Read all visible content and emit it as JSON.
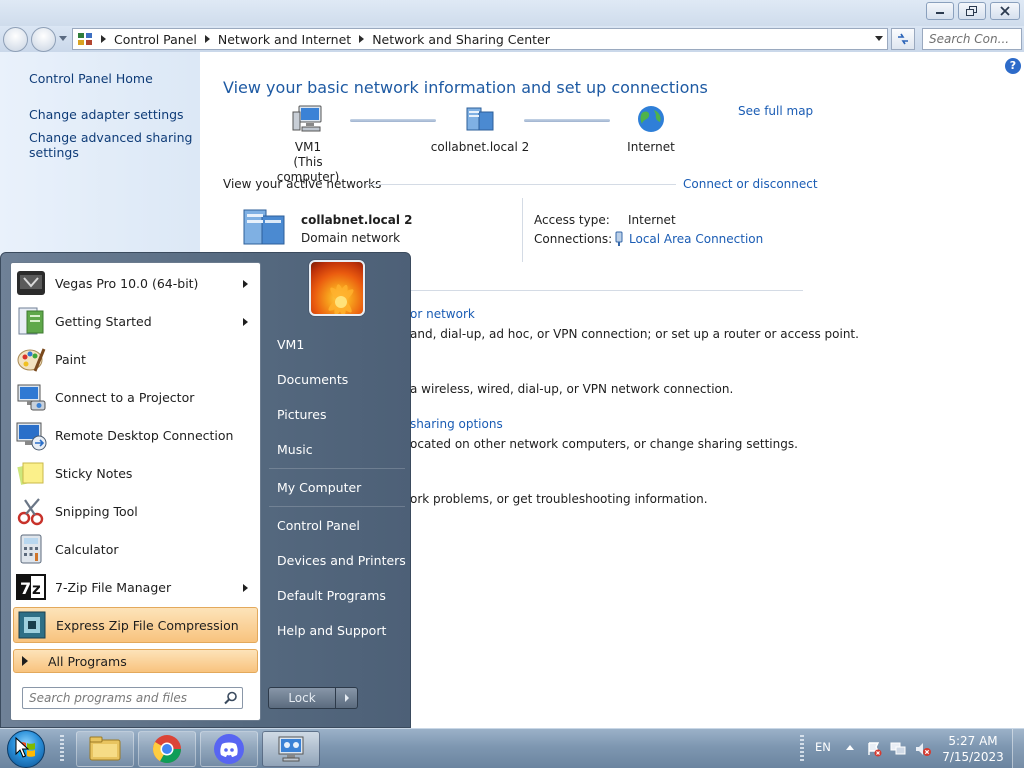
{
  "window": {
    "breadcrumbs": [
      "Control Panel",
      "Network and Internet",
      "Network and Sharing Center"
    ],
    "search_placeholder": "Search Con..."
  },
  "left_nav": {
    "home": "Control Panel Home",
    "items": [
      "Change adapter settings",
      "Change advanced sharing",
      "settings"
    ]
  },
  "main": {
    "title": "View your basic network information and set up connections",
    "see_full_map": "See full map",
    "map_nodes": [
      {
        "name": "VM1",
        "sub": "(This computer)",
        "icon": "computer-icon"
      },
      {
        "name": "collabnet.local  2",
        "sub": "",
        "icon": "domain-network-icon"
      },
      {
        "name": "Internet",
        "sub": "",
        "icon": "globe-icon"
      }
    ],
    "active_networks_label": "View your active networks",
    "connect_or_disconnect": "Connect or disconnect",
    "network_name": "collabnet.local  2",
    "network_type": "Domain network",
    "access_type_label": "Access type:",
    "access_type_value": "Internet",
    "connections_label": "Connections:",
    "connections_value": "Local Area Connection",
    "tasks": [
      {
        "link": "or network",
        "desc": ""
      },
      {
        "link": "",
        "desc": "and, dial-up, ad hoc, or VPN connection; or set up a router or access point."
      },
      {
        "link": "",
        "desc": "a wireless, wired, dial-up, or VPN network connection."
      },
      {
        "link": "sharing options",
        "desc": ""
      },
      {
        "link": "",
        "desc": "ocated on other network computers, or change sharing settings."
      },
      {
        "link": "",
        "desc": "ork problems, or get troubleshooting information."
      }
    ]
  },
  "start_menu": {
    "programs": [
      {
        "label": "Vegas Pro 10.0 (64-bit)",
        "has_submenu": true,
        "icon": "vegas-pro-icon"
      },
      {
        "label": "Getting Started",
        "has_submenu": true,
        "icon": "getting-started-icon"
      },
      {
        "label": "Paint",
        "has_submenu": false,
        "icon": "paint-icon"
      },
      {
        "label": "Connect to a Projector",
        "has_submenu": false,
        "icon": "projector-icon"
      },
      {
        "label": "Remote Desktop Connection",
        "has_submenu": false,
        "icon": "remote-desktop-icon"
      },
      {
        "label": "Sticky Notes",
        "has_submenu": false,
        "icon": "sticky-notes-icon"
      },
      {
        "label": "Snipping Tool",
        "has_submenu": false,
        "icon": "snipping-tool-icon"
      },
      {
        "label": "Calculator",
        "has_submenu": false,
        "icon": "calculator-icon"
      },
      {
        "label": "7-Zip File Manager",
        "has_submenu": true,
        "icon": "seven-zip-icon"
      },
      {
        "label": "Express Zip File Compression",
        "has_submenu": false,
        "icon": "express-zip-icon"
      }
    ],
    "all_programs": "All Programs",
    "search_placeholder": "Search programs and files",
    "right_items": [
      "VM1",
      "Documents",
      "Pictures",
      "Music",
      "My Computer",
      "Control Panel",
      "Devices and Printers",
      "Default Programs",
      "Help and Support"
    ],
    "lock_label": "Lock"
  },
  "taskbar": {
    "language": "EN",
    "time": "5:27 AM",
    "date": "7/15/2023"
  }
}
